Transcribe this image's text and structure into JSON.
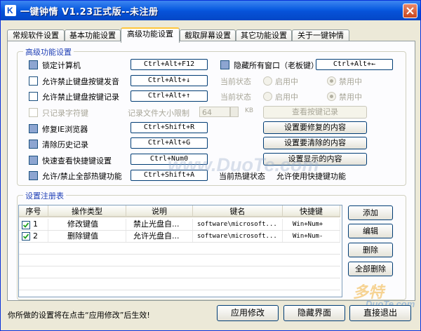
{
  "window": {
    "title": "一键钟情  V1.23正式版--未注册"
  },
  "tabs": [
    {
      "label": "常规软件设置"
    },
    {
      "label": "基本功能设置"
    },
    {
      "label": "高级功能设置"
    },
    {
      "label": "截取屏幕设置"
    },
    {
      "label": "其它功能设置"
    },
    {
      "label": "关于一键钟情"
    }
  ],
  "advanced": {
    "group_title": "高级功能设置",
    "rows": [
      {
        "label": "锁定计算机",
        "checked": true,
        "hotkey": "Ctrl+Alt+F12"
      },
      {
        "label": "允许禁止键盘按键发音",
        "checked": false,
        "hotkey": "Ctrl+Alt+↓"
      },
      {
        "label": "允许禁止键盘按键记录",
        "checked": false,
        "hotkey": "Ctrl+Alt+↑"
      },
      {
        "label": "只记录字符键",
        "checked": false,
        "disabled": true
      },
      {
        "label": "修复IE浏览器",
        "checked": true,
        "hotkey": "Ctrl+Shift+R"
      },
      {
        "label": "清除历史记录",
        "checked": true,
        "hotkey": "Ctrl+Alt+G"
      },
      {
        "label": "快速查看快捷键设置",
        "checked": true,
        "hotkey": "Ctrl+Num0"
      },
      {
        "label": "允许/禁止全部热键功能",
        "checked": true,
        "hotkey": "Ctrl+Shift+A"
      }
    ],
    "hide_windows": {
      "label": "隐藏所有窗口（老板键）",
      "checked": true,
      "hotkey": "Ctrl+Alt+←"
    },
    "status_label": "当前状态",
    "enabled_label": "启用中",
    "disabled_label": "禁用中",
    "log_size_label": "记录文件大小限制",
    "log_size_value": "64",
    "log_size_unit": "KB",
    "view_keys_button": "查看按键记录",
    "repair_button": "设置要修复的内容",
    "clear_button": "设置要清除的内容",
    "display_button": "设置显示的内容",
    "hotkey_status_label": "当前热键状态",
    "hotkey_status_value": "允许使用快捷键功能"
  },
  "registry": {
    "group_title": "设置注册表",
    "columns": [
      "序号",
      "操作类型",
      "说明",
      "键名",
      "快捷键"
    ],
    "rows": [
      {
        "checked": true,
        "index": "1",
        "type": "修改键值",
        "desc": "禁止光盘自...",
        "key": "software\\microsoft...",
        "hotkey": "Win+Num+"
      },
      {
        "checked": true,
        "index": "2",
        "type": "删除键值",
        "desc": "允许光盘自...",
        "key": "software\\microsoft...",
        "hotkey": "Win+Num-"
      }
    ],
    "buttons": {
      "add": "添加",
      "edit": "编辑",
      "delete": "删除",
      "delete_all": "全部删除"
    }
  },
  "footer": {
    "hint": "你所做的设置将在点击“应用修改”后生效!",
    "apply": "应用修改",
    "hide": "隐藏界面",
    "exit": "直接退出"
  },
  "watermarks": {
    "center": "www.DuoTe.com",
    "corner_brand": "多特",
    "corner_site": "DuoTe.com"
  },
  "colors": {
    "titlebar": "#0a5ce0",
    "group_title": "#1f3fb6",
    "active_tab_accent": "#ffc73c"
  }
}
